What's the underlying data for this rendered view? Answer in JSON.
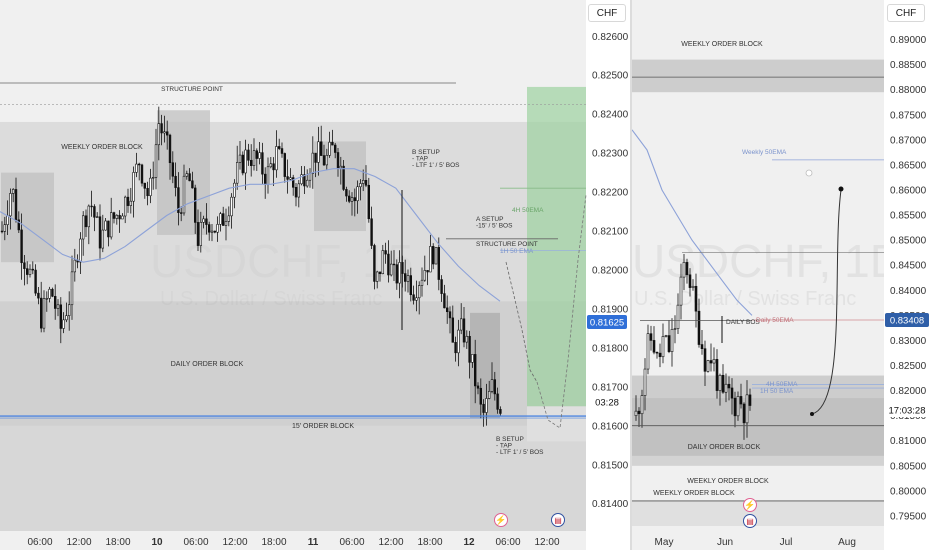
{
  "left_chart": {
    "currency": "CHF",
    "watermark": {
      "symbol": "USDCHF, 15",
      "name": "U.S. Dollar / Swiss Franc"
    },
    "price_badge": "0.81625",
    "countdown": "03:28",
    "icons": [
      "lightning-icon",
      "us-flag-icon"
    ],
    "annotations": {
      "structure_point_top": "STRUCTURE POINT",
      "weekly_ob": "WEEKLY ORDER BLOCK",
      "daily_ob": "DAILY ORDER BLOCK",
      "ob_15": "15' ORDER BLOCK",
      "b_setup_top": [
        "B SETUP",
        "- TAP",
        "- LTF 1' / 5' BOS"
      ],
      "a_setup": [
        "A SETUP",
        "-15' / 5' BOS"
      ],
      "structure_point_mid": "STRUCTURE POINT",
      "ema_4h": "4H 50EMA",
      "ema_1h": "1H 50 EMA",
      "b_setup_bottom": [
        "B SETUP",
        "- TAP",
        "- LTF 1' / 5' BOS"
      ]
    },
    "colors": {
      "ob_zone": "#c8c8c8",
      "daily_zone": "#b9b9b9",
      "target_zone": "#9cd2a0",
      "ema": "#8da2d8",
      "ob15_line": "#4f86e0"
    }
  },
  "right_chart": {
    "currency": "CHF",
    "watermark": {
      "symbol": "USDCHF, 1D",
      "name": "U.S. Dollar / Swiss Franc"
    },
    "price_badge": "0.83408",
    "countdown": "17:03:28",
    "icons": [
      "lightning-icon",
      "us-flag-icon"
    ],
    "annotations": {
      "weekly_ob_top": "WEEKLY ORDER BLOCK",
      "weekly_ema": "Weekly 50EMA",
      "daily_bos": "DAILY BOS",
      "daily_ema": "Daily 50EMA",
      "ema_4h": "4H 50EMA",
      "ema_1h": "1H 50 EMA",
      "daily_ob": "DAILY ORDER BLOCK",
      "weekly_ob_mid": "WEEKLY ORDER BLOCK",
      "weekly_ob_bottom": "WEEKLY ORDER BLOCK"
    }
  },
  "chart_data": [
    {
      "type": "candlestick",
      "title": "USDCHF, 15",
      "xlabel": "",
      "ylabel": "",
      "x_ticks": [
        "06:00",
        "12:00",
        "18:00",
        "10",
        "06:00",
        "12:00",
        "18:00",
        "11",
        "06:00",
        "12:00",
        "18:00",
        "12",
        "06:00",
        "12:00"
      ],
      "y_ticks": [
        "0.82600",
        "0.82500",
        "0.82400",
        "0.82300",
        "0.82200",
        "0.82100",
        "0.82000",
        "0.81900",
        "0.81800",
        "0.81700",
        "0.81600",
        "0.81500",
        "0.81400"
      ],
      "ylim": [
        0.8133,
        0.8267
      ],
      "series": [
        {
          "name": "price",
          "close_path": [
            0.821,
            0.8222,
            0.8205,
            0.8198,
            0.8188,
            0.8195,
            0.8185,
            0.8194,
            0.821,
            0.8218,
            0.8208,
            0.8212,
            0.8215,
            0.822,
            0.8228,
            0.8218,
            0.8238,
            0.823,
            0.8215,
            0.8225,
            0.8208,
            0.8213,
            0.821,
            0.8216,
            0.8225,
            0.823,
            0.8228,
            0.8224,
            0.823,
            0.8225,
            0.822,
            0.8226,
            0.823,
            0.8228,
            0.8232,
            0.8222,
            0.8218,
            0.8226,
            0.8195,
            0.8205,
            0.8198,
            0.82,
            0.8195,
            0.82,
            0.8205,
            0.8195,
            0.818,
            0.8185,
            0.8175,
            0.8162,
            0.817,
            0.8164
          ]
        },
        {
          "name": "EMA",
          "values": [
            0.8215,
            0.8212,
            0.8208,
            0.8204,
            0.8202,
            0.8203,
            0.8206,
            0.821,
            0.8214,
            0.8217,
            0.8219,
            0.8221,
            0.8222,
            0.8222,
            0.8223,
            0.8225,
            0.8226,
            0.8226,
            0.8224,
            0.8221,
            0.8214,
            0.8207,
            0.8201,
            0.8196,
            0.8192
          ]
        }
      ],
      "levels": {
        "structure_point": 0.8248,
        "last_price": 0.81625,
        "ob_15": 0.8162,
        "ema_4h": 0.8221,
        "ema_1h": 0.8205
      }
    },
    {
      "type": "candlestick",
      "title": "USDCHF, 1D",
      "xlabel": "",
      "ylabel": "",
      "x_ticks": [
        "May",
        "Jun",
        "Jul",
        "Aug"
      ],
      "y_ticks": [
        "0.89000",
        "0.88500",
        "0.88000",
        "0.87500",
        "0.87000",
        "0.86500",
        "0.86000",
        "0.85500",
        "0.85000",
        "0.84500",
        "0.84000",
        "0.83500",
        "0.83000",
        "0.82500",
        "0.82000",
        "0.81500",
        "0.81000",
        "0.80500",
        "0.80000",
        "0.79500"
      ],
      "ylim": [
        0.793,
        0.8925
      ],
      "series": [
        {
          "name": "price",
          "close_path": [
            0.815,
            0.82,
            0.828,
            0.831,
            0.825,
            0.83,
            0.828,
            0.832,
            0.838,
            0.846,
            0.842,
            0.835,
            0.83,
            0.825,
            0.827,
            0.822,
            0.818,
            0.82,
            0.817,
            0.819,
            0.816,
            0.8175
          ]
        },
        {
          "name": "EMA",
          "values": [
            0.872,
            0.868,
            0.86,
            0.855,
            0.85,
            0.846,
            0.842,
            0.838,
            0.835
          ]
        }
      ],
      "levels": {
        "weekly_ema": 0.866,
        "daily_bos": 0.834,
        "daily_ema": 0.8341,
        "ema_4h": 0.8212,
        "ema_1h": 0.8205,
        "last_price": 0.83408,
        "projection_target": 0.859
      }
    }
  ]
}
